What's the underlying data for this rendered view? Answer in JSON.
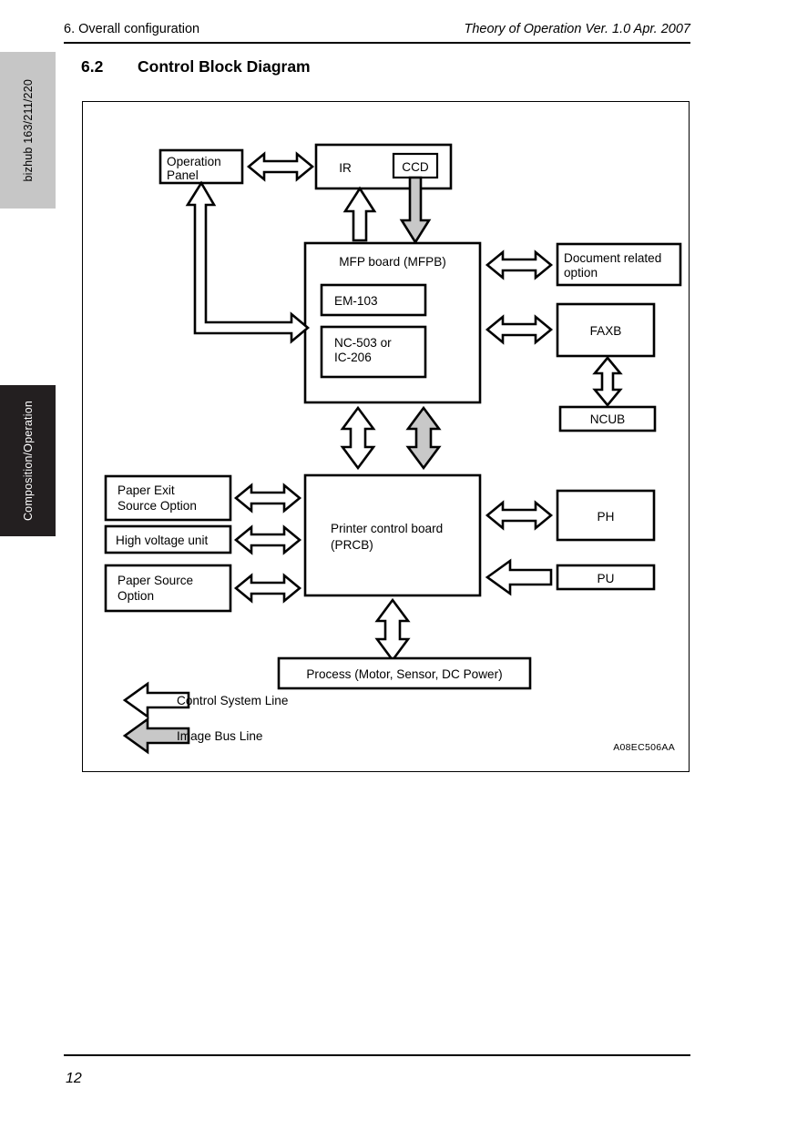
{
  "side_tabs": {
    "product": "bizhub 163/211/220",
    "section": "Composition/Operation"
  },
  "header": {
    "left": "6. Overall configuration",
    "right": "Theory of Operation Ver. 1.0 Apr. 2007"
  },
  "section": {
    "number": "6.2",
    "title": "Control Block Diagram"
  },
  "diagram": {
    "boxes": {
      "operation_panel_line1": "Operation",
      "operation_panel_line2": "Panel",
      "ir": "IR",
      "ccd": "CCD",
      "mfp_board": "MFP board (MFPB)",
      "em103": "EM-103",
      "nc503_line1": "NC-503 or",
      "nc503_line2": "IC-206",
      "document_option_line1": "Document related",
      "document_option_line2": "option",
      "faxb": "FAXB",
      "ncub": "NCUB",
      "paper_exit_line1": "Paper Exit",
      "paper_exit_line2": "Source Option",
      "high_voltage": "High voltage unit",
      "paper_source_line1": "Paper Source",
      "paper_source_line2": "Option",
      "prcb_line1": "Printer control board",
      "prcb_line2": "(PRCB)",
      "ph": "PH",
      "pu": "PU",
      "process": "Process (Motor, Sensor, DC Power)"
    },
    "legend": [
      {
        "label": "Control System Line",
        "type": "control",
        "color": "#ffffff"
      },
      {
        "label": "Image Bus Line",
        "type": "image",
        "color": "#c8c8c8"
      }
    ],
    "figure_code": "A08EC506AA"
  },
  "footer": {
    "page_number": "12"
  }
}
